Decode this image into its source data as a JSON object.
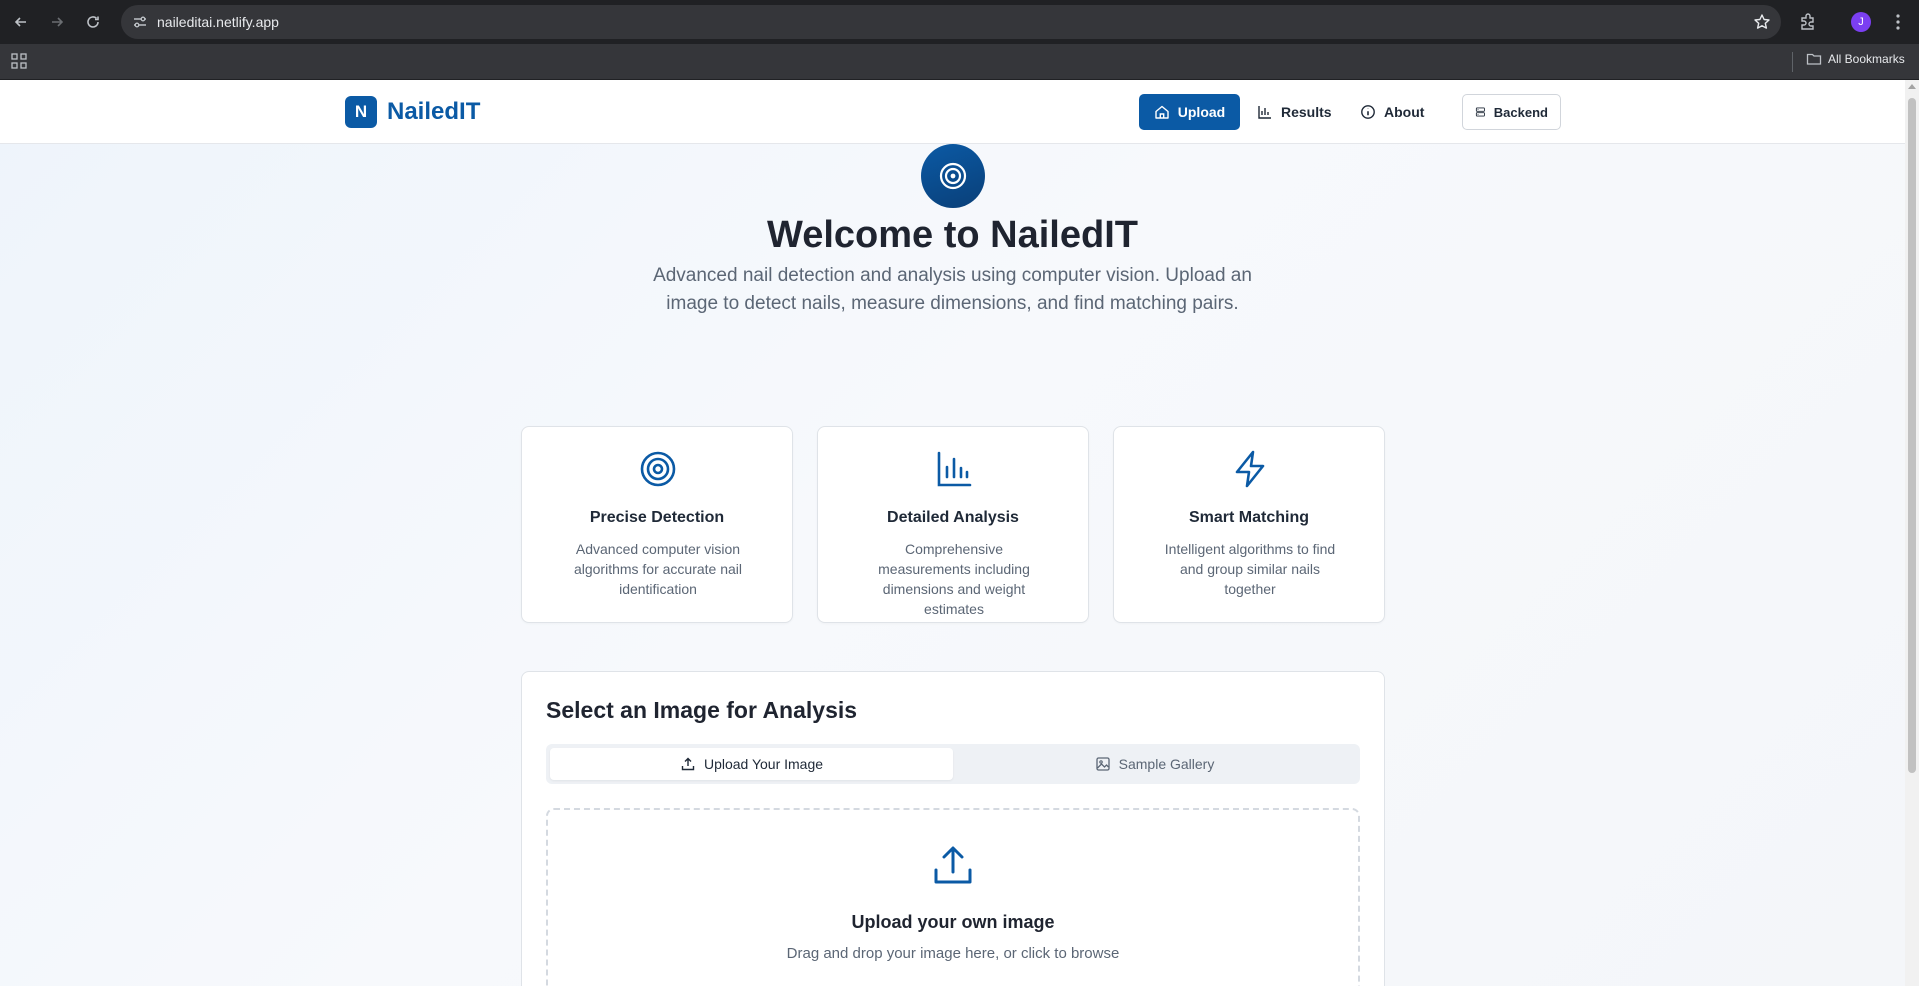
{
  "browser": {
    "url": "naileditai.netlify.app",
    "avatar_initial": "J",
    "bookmarks_label": "All Bookmarks"
  },
  "header": {
    "logo_letter": "N",
    "logo_text": "NailedIT",
    "nav": {
      "upload": "Upload",
      "results": "Results",
      "about": "About",
      "backend": "Backend"
    }
  },
  "hero": {
    "title": "Welcome to NailedIT",
    "subtitle": "Advanced nail detection and analysis using computer vision. Upload an image to detect nails, measure dimensions, and find matching pairs."
  },
  "features": [
    {
      "icon": "target-icon",
      "title": "Precise Detection",
      "description": "Advanced computer vision algorithms for accurate nail identification"
    },
    {
      "icon": "bar-chart-icon",
      "title": "Detailed Analysis",
      "description": "Comprehensive measurements including dimensions and weight estimates"
    },
    {
      "icon": "lightning-icon",
      "title": "Smart Matching",
      "description": "Intelligent algorithms to find and group similar nails together"
    }
  ],
  "upload_section": {
    "title": "Select an Image for Analysis",
    "tabs": {
      "upload": "Upload Your Image",
      "gallery": "Sample Gallery"
    },
    "active_tab": "Upload Your Image",
    "dropzone": {
      "title": "Upload your own image",
      "subtitle": "Drag and drop your image here, or click to browse"
    }
  },
  "colors": {
    "brand": "#0b5aa5",
    "text": "#1f2430",
    "muted": "#5b6675"
  }
}
